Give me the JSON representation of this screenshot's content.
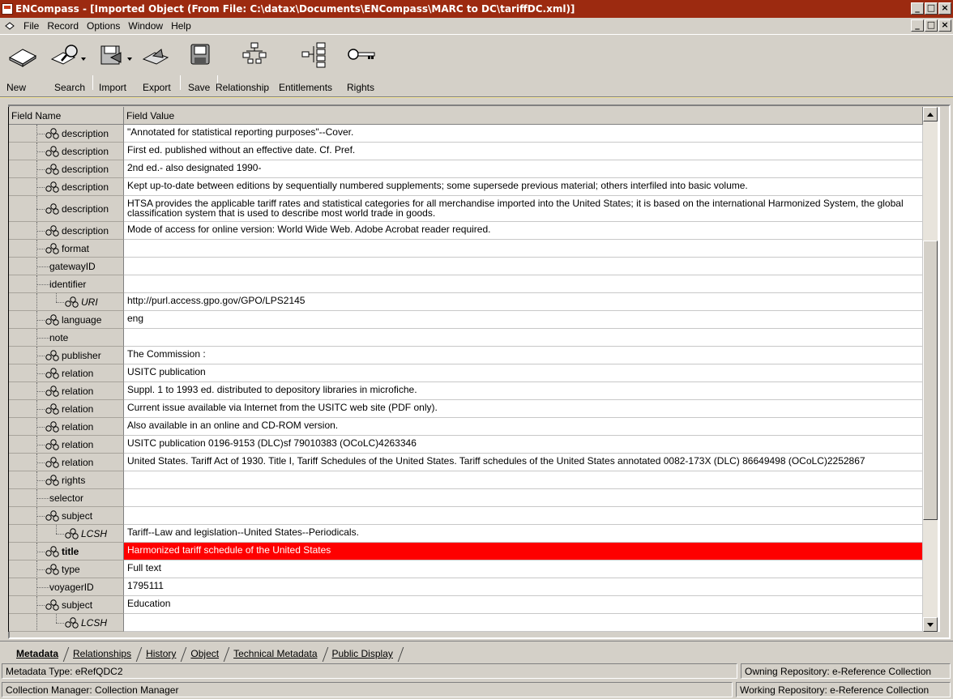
{
  "window": {
    "title": "ENCompass - [Imported Object (From File: C:\\datax\\Documents\\ENCompass\\MARC to DC\\tariffDC.xml)]",
    "buttons": [
      "_",
      "□",
      "×"
    ]
  },
  "menu": [
    "File",
    "Record",
    "Options",
    "Window",
    "Help"
  ],
  "toolbar": [
    {
      "label": "New",
      "icon": "new-record-icon"
    },
    {
      "label": "Search",
      "icon": "search-icon"
    },
    {
      "label": "Import",
      "icon": "import-icon"
    },
    {
      "label": "Export",
      "icon": "export-icon"
    },
    {
      "label": "Save",
      "icon": "save-icon"
    },
    {
      "label": "Relationship",
      "icon": "relationship-icon"
    },
    {
      "label": "Entitlements",
      "icon": "entitlements-icon"
    },
    {
      "label": "Rights",
      "icon": "rights-key-icon"
    }
  ],
  "grid": {
    "header_name": "Field Name",
    "header_value": "Field Value",
    "rows": [
      {
        "name": "description",
        "value": "\"Annotated for statistical reporting purposes\"--Cover.",
        "icon": true
      },
      {
        "name": "description",
        "value": "First ed. published without an effective date. Cf. Pref.",
        "icon": true
      },
      {
        "name": "description",
        "value": "2nd ed.-  also designated 1990-",
        "icon": true
      },
      {
        "name": "description",
        "value": "Kept up-to-date between editions by sequentially numbered supplements; some supersede previous material; others interfiled into basic volume.",
        "icon": true
      },
      {
        "name": "description",
        "value": "HTSA provides the applicable tariff rates and statistical categories for all merchandise imported into the United States; it is based on the  international Harmonized System, the global classification system that is used to describe most world trade in goods.",
        "icon": true,
        "tall": true
      },
      {
        "name": "description",
        "value": "Mode of access for online version: World Wide Web. Adobe Acrobat reader required.",
        "icon": true
      },
      {
        "name": "format",
        "value": "",
        "icon": true
      },
      {
        "name": "gatewayID",
        "value": "",
        "icon": false
      },
      {
        "name": "identifier",
        "value": "",
        "icon": false,
        "parent": true
      },
      {
        "name": "URI",
        "value": "http://purl.access.gpo.gov/GPO/LPS2145",
        "icon": true,
        "child": true,
        "italic": true
      },
      {
        "name": "language",
        "value": "eng",
        "icon": true
      },
      {
        "name": "note",
        "value": "",
        "icon": false
      },
      {
        "name": "publisher",
        "value": "The Commission :",
        "icon": true
      },
      {
        "name": "relation",
        "value": "USITC publication",
        "icon": true
      },
      {
        "name": "relation",
        "value": "Suppl. 1 to 1993 ed. distributed to depository libraries in microfiche.",
        "icon": true
      },
      {
        "name": "relation",
        "value": "Current issue available via Internet from the USITC web site (PDF only).",
        "icon": true
      },
      {
        "name": "relation",
        "value": "Also available in an online and CD-ROM version.",
        "icon": true
      },
      {
        "name": "relation",
        "value": "USITC publication 0196-9153 (DLC)sf 79010383 (OCoLC)4263346",
        "icon": true
      },
      {
        "name": "relation",
        "value": "United States. Tariff Act of 1930.  Title I, Tariff Schedules of the United States. Tariff schedules of the United States annotated 0082-173X (DLC)   86649498 (OCoLC)2252867",
        "icon": true
      },
      {
        "name": "rights",
        "value": "",
        "icon": true
      },
      {
        "name": "selector",
        "value": "",
        "icon": false
      },
      {
        "name": "subject",
        "value": "",
        "icon": true,
        "parent": true
      },
      {
        "name": "LCSH",
        "value": "Tariff--Law and legislation--United States--Periodicals.",
        "icon": true,
        "child": true,
        "italic": true
      },
      {
        "name": "title",
        "value": "Harmonized tariff schedule of the United States",
        "icon": true,
        "bold": true,
        "selected": true
      },
      {
        "name": "type",
        "value": "Full text",
        "icon": true
      },
      {
        "name": "voyagerID",
        "value": "1795111",
        "icon": false
      },
      {
        "name": "subject",
        "value": "Education",
        "icon": true,
        "parent": true
      },
      {
        "name": "LCSH",
        "value": "",
        "icon": true,
        "child": true,
        "italic": true
      }
    ]
  },
  "tabs": [
    {
      "label": "Metadata",
      "active": true
    },
    {
      "label": "Relationships",
      "active": false
    },
    {
      "label": "History",
      "active": false
    },
    {
      "label": "Object",
      "active": false
    },
    {
      "label": "Technical Metadata",
      "active": false
    },
    {
      "label": "Public Display",
      "active": false
    }
  ],
  "status": {
    "metadata_type": "Metadata Type: eRefQDC2",
    "owning_repository": "Owning Repository:  e-Reference Collection",
    "collection_manager": "Collection Manager:  Collection Manager",
    "working_repository": "Working Repository:  e-Reference Collection"
  },
  "colors": {
    "titlebar": "#9c2a10",
    "selected_row": "#fe0000",
    "chrome": "#d4d0c8",
    "desktop": "#f8e89a"
  }
}
